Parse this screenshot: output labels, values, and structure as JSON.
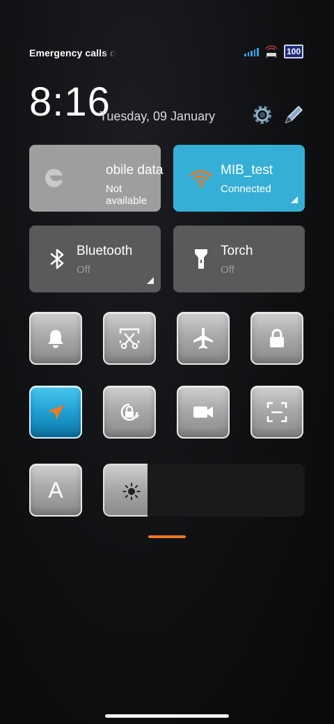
{
  "status_bar": {
    "carrier_text": "Emergency calls only",
    "battery": "100",
    "signal_level": 4
  },
  "header": {
    "time": "8:16",
    "date": "Tuesday, 09 January",
    "settings_icon": "gear-icon",
    "edit_icon": "pencil-icon"
  },
  "tiles": {
    "mobile_data": {
      "title": "obile data",
      "status": "Not available",
      "icon": "mobile-data-icon"
    },
    "wifi": {
      "title": "MIB_test",
      "status": "Connected",
      "icon": "wifi-icon",
      "color": "#36afd6"
    },
    "bluetooth": {
      "title": "Bluetooth",
      "status": "Off",
      "icon": "bluetooth-icon"
    },
    "torch": {
      "title": "Torch",
      "status": "Off",
      "icon": "flashlight-icon"
    }
  },
  "toggles": [
    {
      "name": "notifications",
      "icon": "bell-icon",
      "active": false
    },
    {
      "name": "screenshot",
      "icon": "scissors-icon",
      "active": false
    },
    {
      "name": "airplane-mode",
      "icon": "airplane-icon",
      "active": false
    },
    {
      "name": "lock-screen",
      "icon": "lock-icon",
      "active": false
    },
    {
      "name": "location",
      "icon": "location-arrow-icon",
      "active": true
    },
    {
      "name": "auto-rotate",
      "icon": "rotation-lock-icon",
      "active": false
    },
    {
      "name": "screen-recorder",
      "icon": "video-camera-icon",
      "active": false
    },
    {
      "name": "scanner",
      "icon": "scan-frame-icon",
      "active": false
    }
  ],
  "brightness": {
    "auto_label": "A",
    "icon": "sun-icon",
    "level": 0.22
  },
  "colors": {
    "accent_orange": "#f0781e",
    "active_blue": "#36afd6"
  }
}
